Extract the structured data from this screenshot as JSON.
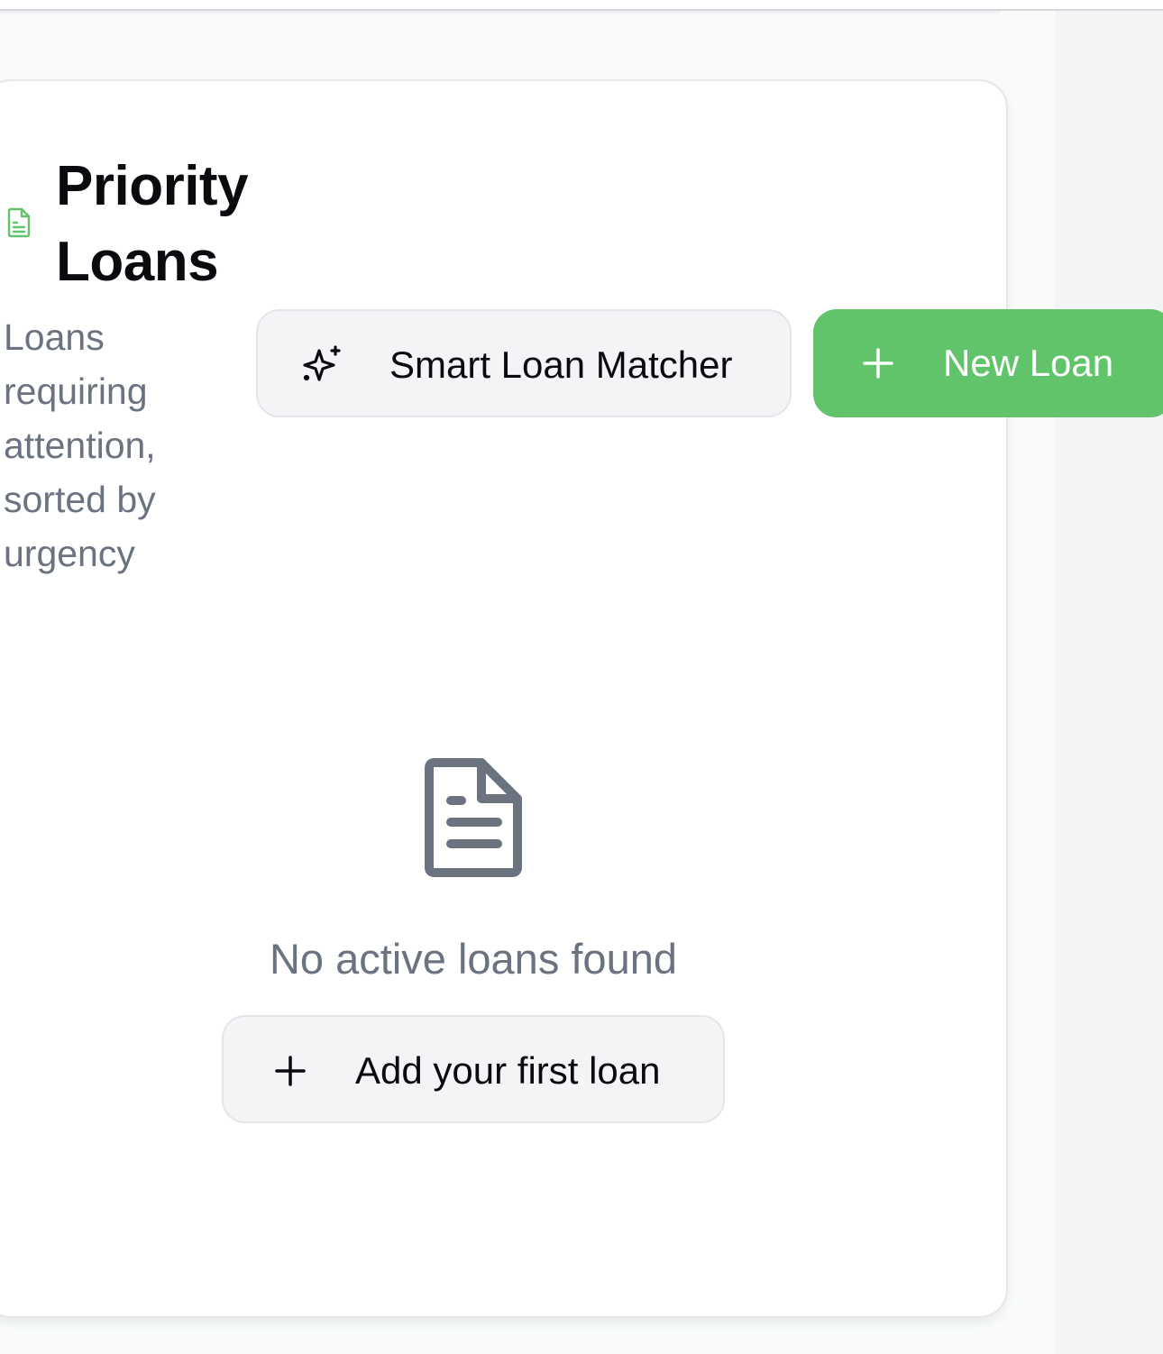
{
  "section": {
    "title": "Priority Loans",
    "subtitle": "Loans requiring attention, sorted by urgency",
    "title_icon": "document-icon"
  },
  "actions": {
    "smart_matcher_label": "Smart Loan Matcher",
    "smart_matcher_icon": "sparkles-icon",
    "new_loan_label": "New Loan",
    "new_loan_icon": "plus-icon"
  },
  "empty_state": {
    "icon": "document-icon",
    "message": "No active loans found",
    "add_first_label": "Add your first loan",
    "add_first_icon": "plus-icon"
  },
  "colors": {
    "accent_green": "#61c46a",
    "muted_text": "#6b7280",
    "button_bg": "#f3f4f6"
  }
}
